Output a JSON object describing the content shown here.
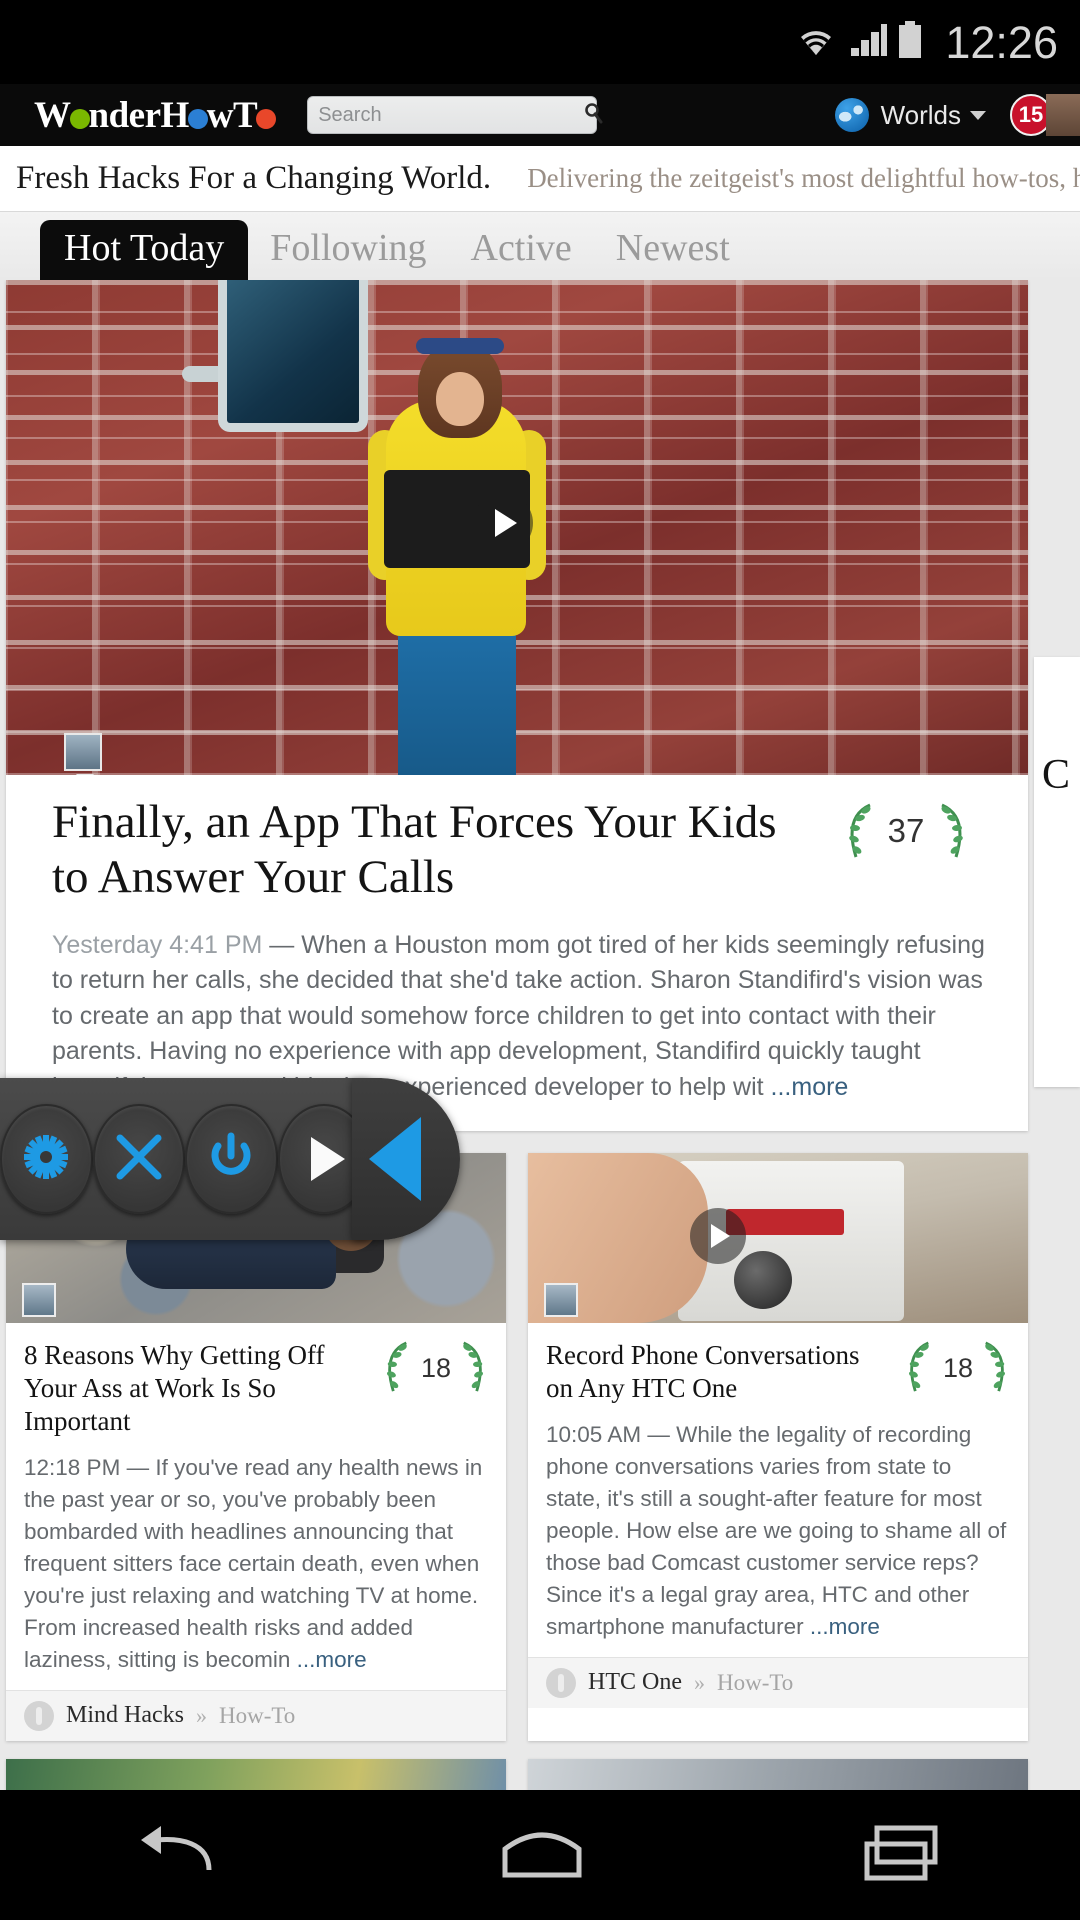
{
  "status_bar": {
    "time": "12:26",
    "icons": [
      "wifi-icon",
      "cellular-signal-icon",
      "battery-icon"
    ]
  },
  "app_bar": {
    "logo_text_1": "W",
    "logo_text_2": "nder",
    "logo_text_3": "H",
    "logo_text_4": "w",
    "logo_text_5": "T",
    "logo_full": "WonderHowTo",
    "search_placeholder": "Search",
    "search_value": "",
    "search_icon": "search-icon",
    "worlds_label": "Worlds",
    "globe_icon": "globe-icon",
    "caret_icon": "chevron-down-icon",
    "notification_count": "15"
  },
  "tagline": {
    "headline": "Fresh Hacks For a Changing World.",
    "subline": "Delivering the zeitgeist's most delightful how-tos, h"
  },
  "tabs": [
    {
      "label": "Hot Today",
      "active": true
    },
    {
      "label": "Following",
      "active": false
    },
    {
      "label": "Active",
      "active": false
    },
    {
      "label": "Newest",
      "active": false
    }
  ],
  "hero_article": {
    "title": "Finally, an App That Forces Your Kids to Answer Your Calls",
    "score": "37",
    "timestamp": "Yesterday 4:41 PM",
    "dash": " — ",
    "body": "When a Houston mom got tired of her kids seemingly refusing to return her calls, she decided that she'd take action. Sharon Standifird's vision was to create an app that would somehow force children to get into contact with their parents. Having no experience with app development, Standifird quickly taught herself the ropes and hired an experienced developer to help wit ",
    "more_label": "...more",
    "play_icon": "play-icon",
    "avatar": "poster-avatar"
  },
  "peek_card_right": {
    "partial_text": "C"
  },
  "cards": [
    {
      "title": "8 Reasons Why Getting Off Your Ass at Work Is So Important",
      "score": "18",
      "timestamp": "12:18 PM",
      "dash": " — ",
      "body": "If you've read any health news in the past year or so, you've probably been bombarded with headlines announcing that frequent sitters face certain death, even when you're just relaxing and watching TV at home. From increased health risks and added laziness, sitting is becomin ",
      "more_label": "...more",
      "world": "Mind Hacks",
      "separator": "»",
      "type": "How-To",
      "has_play": false
    },
    {
      "title": "Record Phone Conversations on Any HTC One",
      "score": "18",
      "timestamp": "10:05 AM",
      "dash": " — ",
      "body": "While the legality of recording phone conversations varies from state to state, it's still a sought-after feature for most people. How else are we going to shame all of those bad Comcast customer service reps? Since it's a legal gray area, HTC and other smartphone manufacturer ",
      "more_label": "...more",
      "world": "HTC One",
      "separator": "»",
      "type": "How-To",
      "has_play": true
    }
  ],
  "overlay_toolbar": {
    "buttons": [
      {
        "name": "settings-gear-icon",
        "color": "#1e9ae4"
      },
      {
        "name": "close-x-icon",
        "color": "#1e9ae4"
      },
      {
        "name": "power-icon",
        "color": "#1e9ae4"
      },
      {
        "name": "play-icon",
        "color": "#fafafa"
      }
    ],
    "handle_icon": "collapse-left-triangle-icon",
    "handle_color": "#1e9ae4"
  },
  "nav_bar": {
    "items": [
      {
        "name": "back-nav-button",
        "icon": "back-arrow-icon"
      },
      {
        "name": "home-nav-button",
        "icon": "home-icon"
      },
      {
        "name": "recents-nav-button",
        "icon": "recents-icon"
      }
    ]
  },
  "colors": {
    "accent_blue": "#1e9ae4",
    "badge_red": "#c8112b",
    "link_blue": "#39607f",
    "wreath_green": "#3f8f4f",
    "body_gray": "#666a6e"
  }
}
